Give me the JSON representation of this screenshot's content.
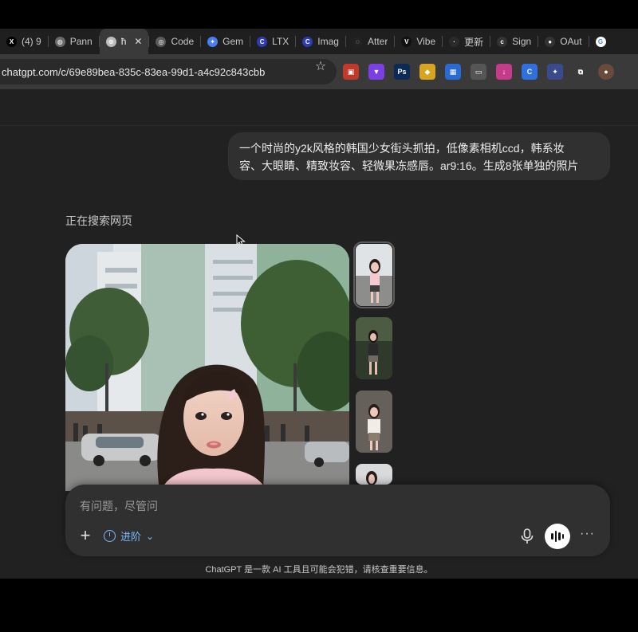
{
  "colors": {
    "page_bg": "#212121",
    "bubble_bg": "#303030",
    "accent_blue": "#7cb8ff",
    "tab_bg": "#1f1f1f",
    "toolbar_bg": "#3a3a3a"
  },
  "tabs": [
    {
      "label": "(4) 9",
      "icon": "x-icon",
      "color": "#000000",
      "glyph": "X"
    },
    {
      "label": "Pann",
      "icon": "globe-icon",
      "color": "#6b6b6b",
      "glyph": "◍"
    },
    {
      "label": "ħ",
      "icon": "chatgpt-icon",
      "color": "#bdbdbd",
      "glyph": "⊛",
      "active": true
    },
    {
      "label": "Code",
      "icon": "openai-icon",
      "color": "#5a5a5a",
      "glyph": "◎"
    },
    {
      "label": "Gem",
      "icon": "gemini-icon",
      "color": "#4a7df0",
      "glyph": "✦"
    },
    {
      "label": "LTX",
      "icon": "c-icon",
      "color": "#2d3bb5",
      "glyph": "C"
    },
    {
      "label": "Imag",
      "icon": "c-icon",
      "color": "#2d3bb5",
      "glyph": "C"
    },
    {
      "label": "Atter",
      "icon": "loop-icon",
      "color": "#222222",
      "glyph": "◌"
    },
    {
      "label": "Vibe",
      "icon": "v-icon",
      "color": "#111111",
      "glyph": "V"
    },
    {
      "label": "更新",
      "icon": "dark-icon",
      "color": "#2a2a2a",
      "glyph": "·"
    },
    {
      "label": "Sign",
      "icon": "c-outline-icon",
      "color": "#333333",
      "glyph": "c"
    },
    {
      "label": "OAut",
      "icon": "github-icon",
      "color": "#333333",
      "glyph": "●"
    },
    {
      "label": "",
      "icon": "google-icon",
      "color": "#ffffff",
      "glyph": "G"
    }
  ],
  "toolbar": {
    "url": "chatgpt.com/c/69e89bea-835c-83ea-99d1-a4c92c843cbb",
    "star_icon": "☆",
    "extensions": [
      {
        "name": "red-ext-icon",
        "color": "#c0392b",
        "glyph": "▣"
      },
      {
        "name": "purple-ext-icon",
        "color": "#7b3fe4",
        "glyph": "▼"
      },
      {
        "name": "photoshop-icon",
        "color": "#0b2a55",
        "glyph": "Ps"
      },
      {
        "name": "yellow-ext-icon",
        "color": "#d9a521",
        "glyph": "◆"
      },
      {
        "name": "blue-ext-icon",
        "color": "#2a6bd1",
        "glyph": "▦"
      },
      {
        "name": "image-ext-icon",
        "color": "#555555",
        "glyph": "▭"
      },
      {
        "name": "download-ext-icon",
        "color": "#c43b8a",
        "glyph": "↓"
      },
      {
        "name": "c-ext-icon",
        "color": "#2f6fe0",
        "glyph": "C"
      },
      {
        "name": "pin-ext-icon",
        "color": "#3b4a8c",
        "glyph": "✦"
      },
      {
        "name": "puzzle-icon",
        "color": "#3a3a3a",
        "glyph": "⧉"
      },
      {
        "name": "profile-avatar",
        "color": "#6a4a3a",
        "glyph": "●"
      }
    ]
  },
  "chat": {
    "user_message_line1": "一个时尚的y2k风格的韩国少女街头抓拍，低像素相机ccd，韩系妆",
    "user_message_line2": "容、大眼睛、精致妆容、轻微果冻感唇。ar9:16。生成8张单独的照片",
    "status": "正在搜索网页",
    "scroll_icon": "↓"
  },
  "composer": {
    "placeholder": "有问题，尽管问",
    "plus": "+",
    "mode_label": "进阶",
    "chevron": "⌄",
    "more": "···"
  },
  "footer": {
    "disclaimer": "ChatGPT 是一款 AI 工具且可能会犯错，请核查重要信息。"
  }
}
